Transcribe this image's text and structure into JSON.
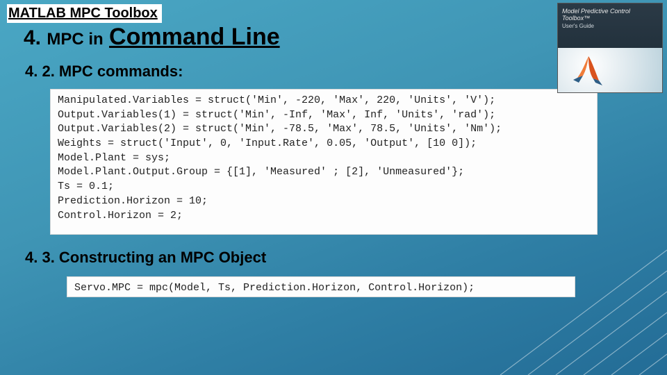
{
  "breadcrumb": "MATLAB MPC Toolbox",
  "section": {
    "number": "4.",
    "small": "MPC in",
    "big": "Command Line"
  },
  "sub42": "4. 2. MPC commands:",
  "sub43": "4. 3. Constructing an MPC Object",
  "code_block_1": "Manipulated.Variables = struct('Min', -220, 'Max', 220, 'Units', 'V');\nOutput.Variables(1) = struct('Min', -Inf, 'Max', Inf, 'Units', 'rad');\nOutput.Variables(2) = struct('Min', -78.5, 'Max', 78.5, 'Units', 'Nm');\nWeights = struct('Input', 0, 'Input.Rate', 0.05, 'Output', [10 0]);\nModel.Plant = sys;\nModel.Plant.Output.Group = {[1], 'Measured' ; [2], 'Unmeasured'};\nTs = 0.1;\nPrediction.Horizon = 10;\nControl.Horizon = 2;",
  "code_block_2": "Servo.MPC = mpc(Model, Ts, Prediction.Horizon, Control.Horizon);",
  "book": {
    "title": "Model Predictive Control Toolbox™",
    "subtitle": "User's Guide"
  }
}
